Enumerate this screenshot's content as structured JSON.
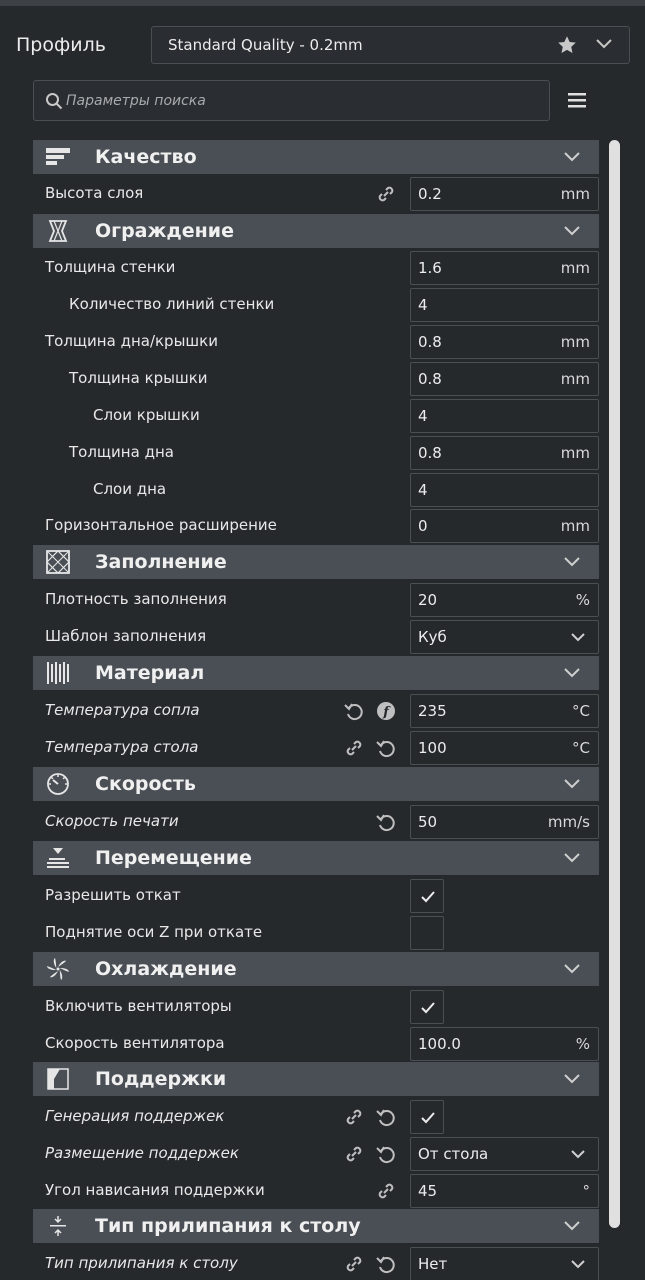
{
  "header": {
    "profile_label": "Профиль",
    "profile_value": "Standard Quality - 0.2mm",
    "search_placeholder": "Параметры поиска"
  },
  "colors": {
    "background": "#26292c",
    "category_bar": "#4a4f55",
    "field_border": "#4a4f54",
    "scrollbar": "#e0e0e0"
  },
  "categories": {
    "quality": {
      "title": "Качество",
      "icon": "quality-icon"
    },
    "shell": {
      "title": "Ограждение",
      "icon": "shell-icon"
    },
    "infill": {
      "title": "Заполнение",
      "icon": "infill-icon"
    },
    "material": {
      "title": "Материал",
      "icon": "material-icon"
    },
    "speed": {
      "title": "Скорость",
      "icon": "speed-icon"
    },
    "travel": {
      "title": "Перемещение",
      "icon": "travel-icon"
    },
    "cooling": {
      "title": "Охлаждение",
      "icon": "fan-icon"
    },
    "support": {
      "title": "Поддержки",
      "icon": "support-icon"
    },
    "adhesion": {
      "title": "Тип прилипания к столу",
      "icon": "adhesion-icon"
    }
  },
  "settings": {
    "layer_height": {
      "label": "Высота слоя",
      "value": "0.2",
      "unit": "mm"
    },
    "wall_thickness": {
      "label": "Толщина стенки",
      "value": "1.6",
      "unit": "mm"
    },
    "wall_line_count": {
      "label": "Количество линий стенки",
      "value": "4"
    },
    "top_bottom_thickness": {
      "label": "Толщина дна/крышки",
      "value": "0.8",
      "unit": "mm"
    },
    "top_thickness": {
      "label": "Толщина крышки",
      "value": "0.8",
      "unit": "mm"
    },
    "top_layers": {
      "label": "Слои крышки",
      "value": "4"
    },
    "bottom_thickness": {
      "label": "Толщина дна",
      "value": "0.8",
      "unit": "mm"
    },
    "bottom_layers": {
      "label": "Слои дна",
      "value": "4"
    },
    "horizontal_expansion": {
      "label": "Горизонтальное расширение",
      "value": "0",
      "unit": "mm"
    },
    "infill_density": {
      "label": "Плотность заполнения",
      "value": "20",
      "unit": "%"
    },
    "infill_pattern": {
      "label": "Шаблон заполнения",
      "value": "Куб"
    },
    "nozzle_temp": {
      "label": "Температура сопла",
      "value": "235",
      "unit": "°C"
    },
    "bed_temp": {
      "label": "Температура стола",
      "value": "100",
      "unit": "°C"
    },
    "print_speed": {
      "label": "Скорость печати",
      "value": "50",
      "unit": "mm/s"
    },
    "enable_retraction": {
      "label": "Разрешить откат",
      "checked": true
    },
    "z_hop": {
      "label": "Поднятие оси Z при откате",
      "checked": false
    },
    "enable_fans": {
      "label": "Включить вентиляторы",
      "checked": true
    },
    "fan_speed": {
      "label": "Скорость вентилятора",
      "value": "100.0",
      "unit": "%"
    },
    "generate_support": {
      "label": "Генерация поддержек",
      "checked": true
    },
    "support_placement": {
      "label": "Размещение поддержек",
      "value": "От стола"
    },
    "support_angle": {
      "label": "Угол нависания поддержки",
      "value": "45",
      "unit": "°"
    },
    "adhesion_type": {
      "label": "Тип прилипания к столу",
      "value": "Нет"
    }
  }
}
